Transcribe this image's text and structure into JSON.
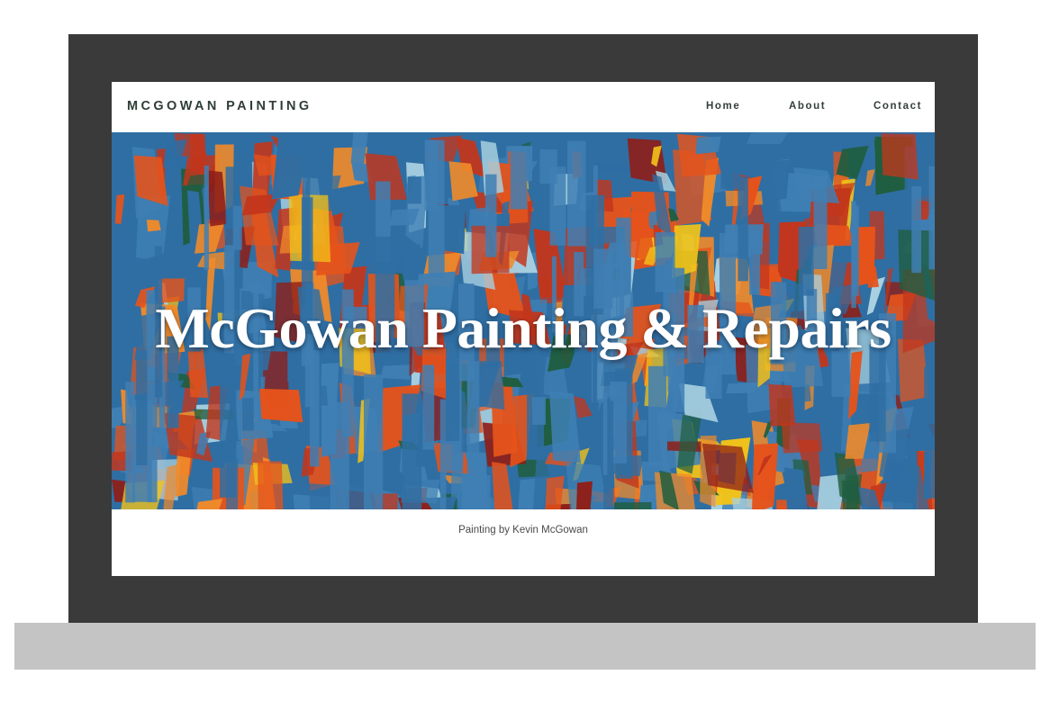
{
  "header": {
    "brand": "MCGOWAN PAINTING",
    "nav": [
      "Home",
      "About",
      "Contact"
    ]
  },
  "hero": {
    "title": "McGowan Painting & Repairs",
    "caption": "Painting by Kevin McGowan"
  },
  "colors": {
    "bezel": "#3a3a3a",
    "base": "#c4c4c4",
    "brand_text": "#2f3e36",
    "painting_palette": [
      "#2f6ea3",
      "#3f7fb4",
      "#e5531b",
      "#c2361c",
      "#8e1e18",
      "#f2c319",
      "#f08a2a",
      "#1f5e3f",
      "#a8d0e0"
    ]
  }
}
